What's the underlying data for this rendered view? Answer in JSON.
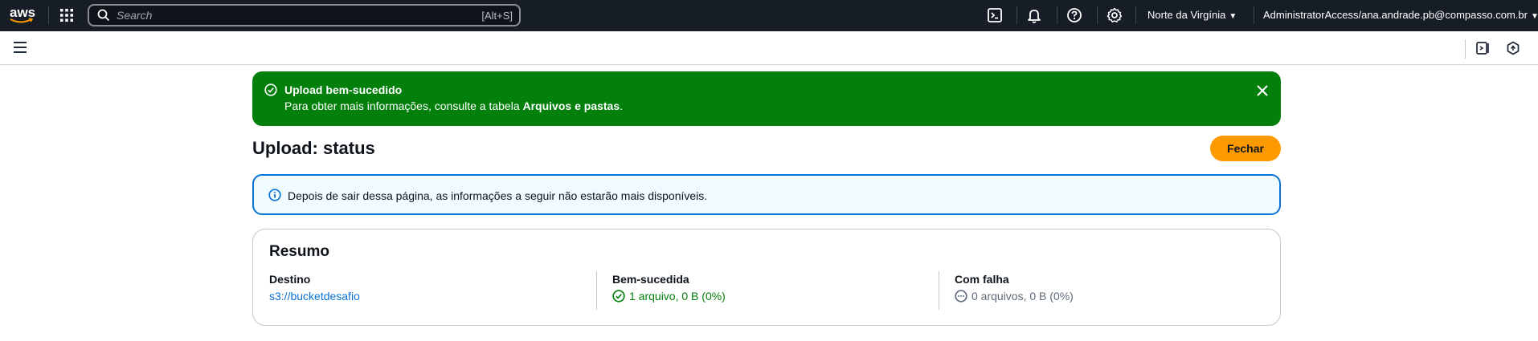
{
  "topnav": {
    "logo_text": "aws",
    "search_placeholder": "Search",
    "search_shortcut": "[Alt+S]",
    "icons": [
      "cloudshell-icon",
      "bell-icon",
      "help-icon",
      "gear-icon"
    ],
    "region": "Norte da Virgínia",
    "account": "AdministratorAccess/ana.andrade.pb@compasso.com.br"
  },
  "flash": {
    "title": "Upload bem-sucedido",
    "message_prefix": "Para obter mais informações, consulte a tabela ",
    "message_bold": "Arquivos e pastas",
    "message_suffix": "."
  },
  "page": {
    "title": "Upload: status",
    "close_button": "Fechar"
  },
  "info_alert": {
    "text": "Depois de sair dessa página, as informações a seguir não estarão mais disponíveis."
  },
  "summary": {
    "title": "Resumo",
    "destination": {
      "label": "Destino",
      "value": "s3://bucketdesafio"
    },
    "succeeded": {
      "label": "Bem-sucedida",
      "value": "1 arquivo, 0 B (0%)"
    },
    "failed": {
      "label": "Com falha",
      "value": "0 arquivos, 0 B (0%)"
    }
  },
  "colors": {
    "nav_bg": "#161d26",
    "success": "#037f0c",
    "info_border": "#0972d3",
    "primary_button": "#ff9900",
    "link": "#0972d3"
  }
}
